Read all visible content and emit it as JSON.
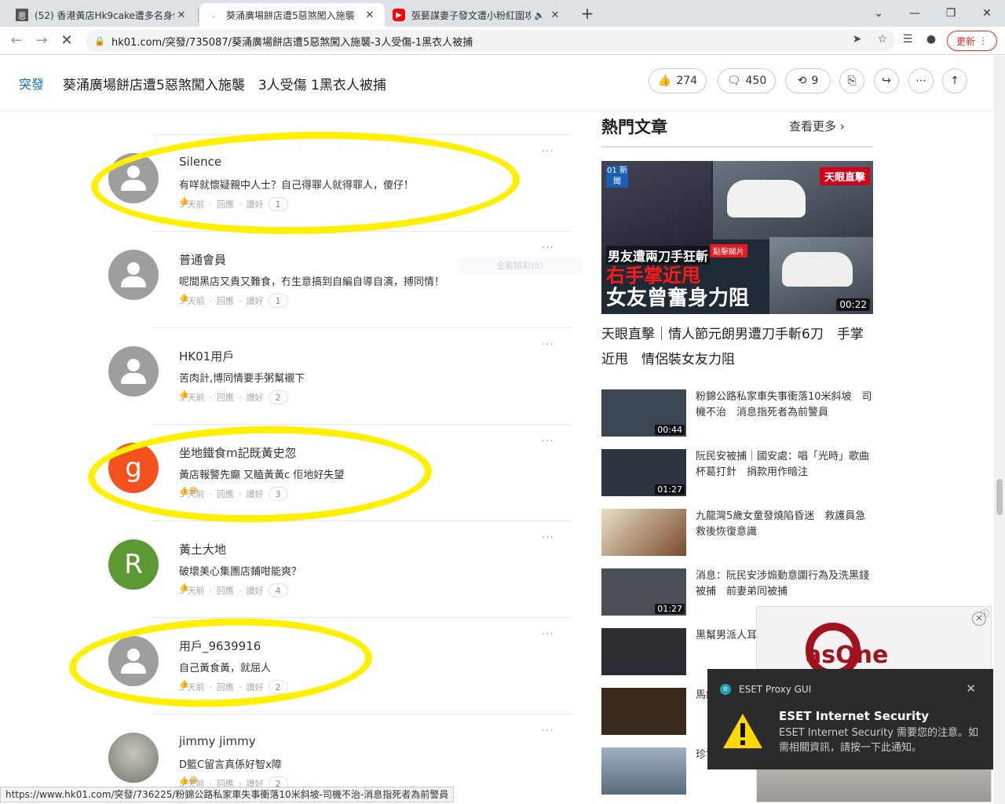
{
  "browser": {
    "tabs": [
      {
        "title": "(52) 香港黃店Hk9cake遭多名身份",
        "favicon": "恩"
      },
      {
        "title": "葵涌廣場餅店遭5惡煞闖入施襲",
        "favicon": "."
      },
      {
        "title": "張藝謀妻子發文遭小粉紅圍攻",
        "favicon": "▶"
      }
    ],
    "url": "hk01.com/突發/735087/葵涌廣場餅店遭5惡煞闖入施襲-3人受傷-1黑衣人被捕",
    "update_label": "更新",
    "status_url": "https://www.hk01.com/突發/736225/粉錦公路私家車失事衝落10米斜坡-司機不治-消息指死者為前警員"
  },
  "header": {
    "section": "突發",
    "title": "葵涌廣場餅店遭5惡煞闖入施襲　3人受傷 1黑衣人被捕",
    "likes": "274",
    "comments": "450",
    "shares": "9"
  },
  "comments": [
    {
      "name": "Silence",
      "text": "有咩就懷疑親中人士？自己得罪人就得罪人，傻仔！",
      "time": "3 天前",
      "reply": "回應",
      "praise": "讚好",
      "likes": "1",
      "avatar": "default",
      "emoji": "👍"
    },
    {
      "name": "普通會員",
      "text": "呢間黑店又貴又難食，冇生意搞到自編自導自演，搏同情！",
      "time": "3 天前",
      "reply": "回應",
      "praise": "讚好",
      "likes": "1",
      "avatar": "default",
      "emoji": "👍"
    },
    {
      "name": "HK01用戶",
      "text": "苦肉計,博同情要手粥幫襯下",
      "time": "3 天前",
      "reply": "回應",
      "praise": "讚好",
      "likes": "2",
      "avatar": "default",
      "emoji": "👍"
    },
    {
      "name": "坐地鐵食m記既黃史忽",
      "text": "黃店報警先癲 又瞌黃黃c 佢地好失望",
      "time": "3 天前",
      "reply": "回應",
      "praise": "讚好",
      "likes": "3",
      "avatar": "g",
      "avatar_color": "#f4511e",
      "emoji": "👍😂"
    },
    {
      "name": "黃土大地",
      "text": "破壞美心集團店鋪咁能爽？",
      "time": "3 天前",
      "reply": "回應",
      "praise": "讚好",
      "likes": "4",
      "avatar": "R",
      "avatar_color": "#5b9a32",
      "emoji": "👍"
    },
    {
      "name": "用戶_9639916",
      "text": "自己黃食黃，就屈人",
      "time": "3 天前",
      "reply": "回應",
      "praise": "讚好",
      "likes": "2",
      "avatar": "default",
      "emoji": "👍"
    },
    {
      "name": "jimmy jimmy",
      "text": "D籃C留言真係好智x障",
      "time": "3 天前",
      "reply": "回應",
      "praise": "讚好",
      "likes": "2",
      "avatar": "photo",
      "emoji": "👍😂"
    }
  ],
  "ghost_button": "全看精彩(5)",
  "sidebar": {
    "title": "熱門文章",
    "more": "查看更多",
    "hero": {
      "title": "天眼直擊｜情人節元朗男遭刀手斬6刀　手掌近甩　情侶裝女友力阻",
      "tag": "天眼直擊",
      "caption1": "男友遭兩刀手狂斬",
      "caption2": "右手掌近甩",
      "caption3": "女友曾奮身力阻",
      "badge": "點擊睇片",
      "logo": "01 新聞",
      "duration": "00:22"
    },
    "articles": [
      {
        "title": "粉錦公路私家車失事衝落10米斜坡　司機不治　消息指死者為前警員",
        "duration": "00:44",
        "color": "#3c4652"
      },
      {
        "title": "阮民安被捕｜國安處：唱「光時」歌曲　杯葛打針　捐款用作暗注",
        "duration": "01:27",
        "color": "#2e3440"
      },
      {
        "title": "九龍灣5歲女童發燒陷昏迷　救護員急救後恢復意識",
        "duration": "",
        "color": "#7a4a2a"
      },
      {
        "title": "消息：阮民安涉煽動意圖行為及洗黑錢被捕　前妻弟同被捕",
        "duration": "01:27",
        "color": "#4a4f58"
      },
      {
        "title": "黑幫男派人耳「吹大咗」私",
        "duration": "",
        "color": "#2b2d33"
      },
      {
        "title": "馬組",
        "duration": "",
        "color": "#3a2a1e"
      },
      {
        "title": "珍亡",
        "duration": "",
        "color": "#5a6a7a"
      }
    ]
  },
  "ad": {
    "brand": "asOne",
    "info": "ⓘ",
    "close": "✕"
  },
  "notification": {
    "app": "ESET Proxy GUI",
    "title": "ESET Internet Security",
    "body": "ESET Internet Security 需要您的注意。如需相關資訊，請按一下此通知。"
  }
}
